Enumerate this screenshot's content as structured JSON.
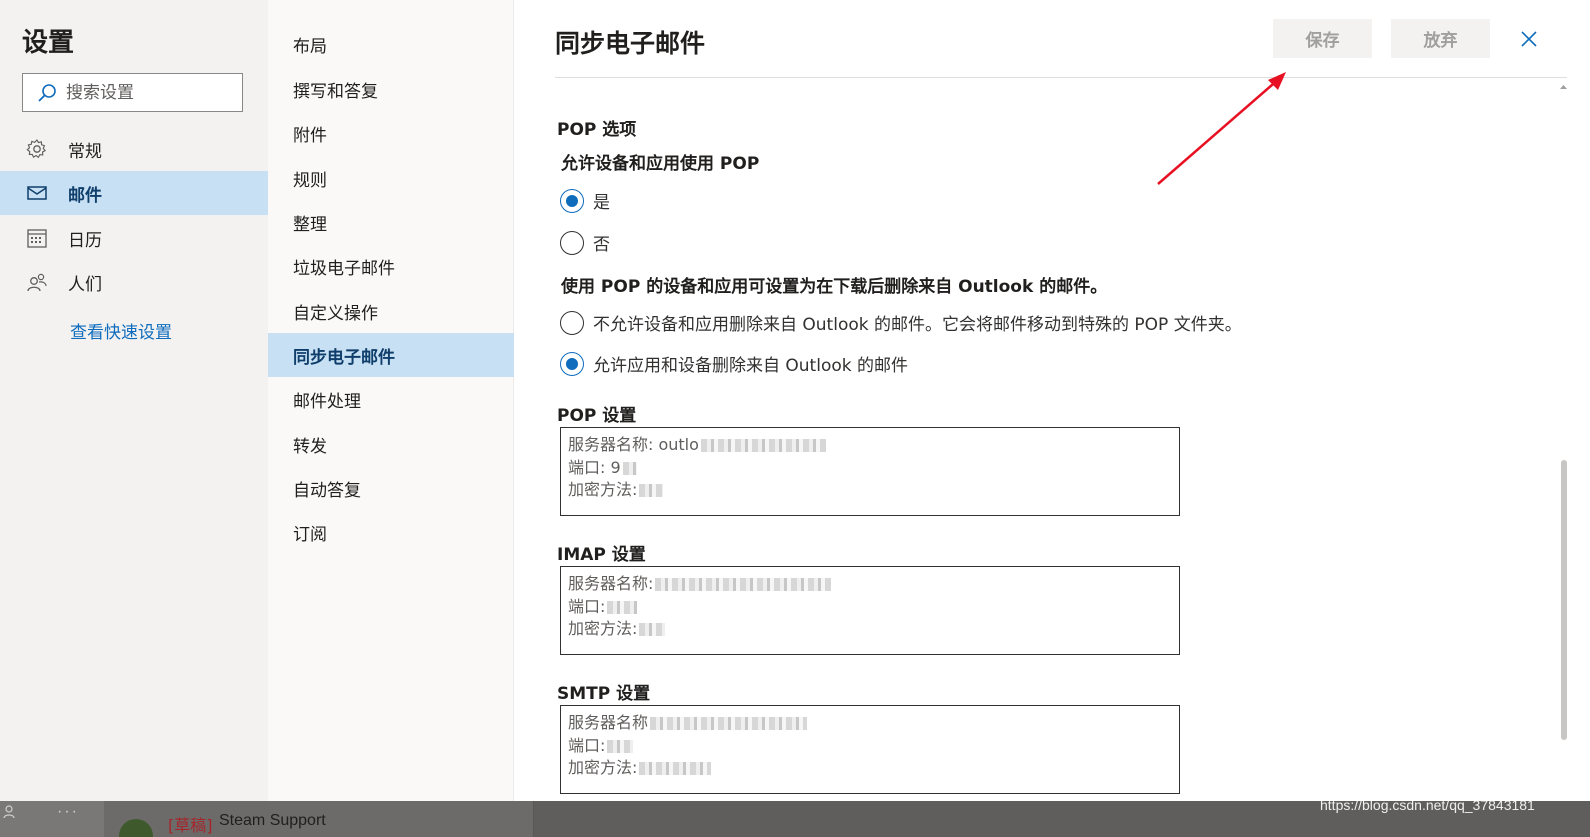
{
  "settings": {
    "title": "设置",
    "search_placeholder": "搜索设置",
    "categories": [
      {
        "label": "常规",
        "icon": "gear-icon"
      },
      {
        "label": "邮件",
        "icon": "mail-icon",
        "active": true
      },
      {
        "label": "日历",
        "icon": "calendar-icon"
      },
      {
        "label": "人们",
        "icon": "people-icon"
      }
    ],
    "quick_settings_link": "查看快速设置"
  },
  "mail_nav": {
    "items": [
      {
        "label": "布局"
      },
      {
        "label": "撰写和答复"
      },
      {
        "label": "附件"
      },
      {
        "label": "规则"
      },
      {
        "label": "整理"
      },
      {
        "label": "垃圾电子邮件"
      },
      {
        "label": "自定义操作"
      },
      {
        "label": "同步电子邮件",
        "active": true
      },
      {
        "label": "邮件处理"
      },
      {
        "label": "转发"
      },
      {
        "label": "自动答复"
      },
      {
        "label": "订阅"
      }
    ]
  },
  "panel": {
    "title": "同步电子邮件",
    "save_label": "保存",
    "discard_label": "放弃",
    "pop_options_heading": "POP 选项",
    "allow_pop_question": "允许设备和应用使用 POP",
    "allow_pop_yes": "是",
    "allow_pop_no": "否",
    "allow_pop_selected": "是",
    "delete_question": "使用 POP 的设备和应用可设置为在下载后删除来自 Outlook 的邮件。",
    "delete_option_disallow": "不允许设备和应用删除来自 Outlook 的邮件。它会将邮件移动到特殊的 POP 文件夹。",
    "delete_option_allow": "允许应用和设备删除来自 Outlook 的邮件",
    "delete_selected": "允许应用和设备删除来自 Outlook 的邮件",
    "pop_settings": {
      "heading": "POP 设置",
      "server_label": "服务器名称: outlo",
      "port_label": "端口: 9",
      "encryption_label": "加密方法:"
    },
    "imap_settings": {
      "heading": "IMAP 设置",
      "server_label": "服务器名称:",
      "port_label": "端口:",
      "encryption_label": "加密方法:"
    },
    "smtp_settings": {
      "heading": "SMTP 设置",
      "server_label": "服务器名称",
      "port_label": "端口:",
      "encryption_label": "加密方法:"
    }
  },
  "background": {
    "draft_tag": "[草稿]",
    "draft_sender": "Steam Support",
    "watermark": "https://blog.csdn.net/qq_37843181"
  },
  "colors": {
    "accent": "#0f6cbd",
    "selected_bg": "#c7e0f4",
    "annotation_arrow": "#e81123"
  }
}
